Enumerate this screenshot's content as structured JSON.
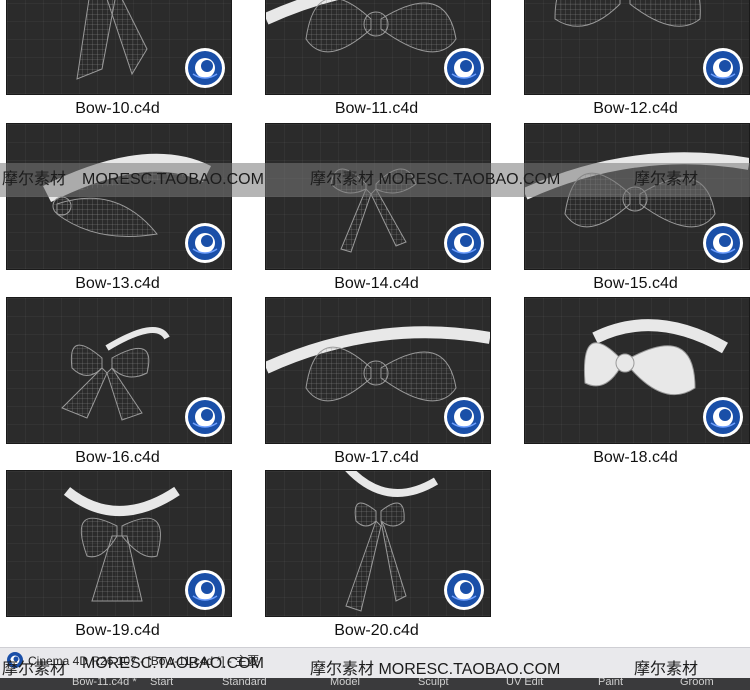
{
  "files": [
    {
      "name": "Bow-10.c4d",
      "variant": "tie"
    },
    {
      "name": "Bow-11.c4d",
      "variant": "bow-band"
    },
    {
      "name": "Bow-12.c4d",
      "variant": "bow-wide"
    },
    {
      "name": "Bow-13.c4d",
      "variant": "bow-side"
    },
    {
      "name": "Bow-14.c4d",
      "variant": "ribbon"
    },
    {
      "name": "Bow-15.c4d",
      "variant": "bow-band"
    },
    {
      "name": "Bow-16.c4d",
      "variant": "bow-cloth"
    },
    {
      "name": "Bow-17.c4d",
      "variant": "bow-band"
    },
    {
      "name": "Bow-18.c4d",
      "variant": "bow-smooth"
    },
    {
      "name": "Bow-19.c4d",
      "variant": "bow-collar"
    },
    {
      "name": "Bow-20.c4d",
      "variant": "tie-ribbon"
    }
  ],
  "watermark": {
    "text_a": "摩尔素材",
    "text_b": "MORESC.TAOBAO.COM",
    "text_c": "摩尔素材 MORESC.TAOBAO.COM",
    "text_d": "摩尔素材"
  },
  "taskbar": {
    "title": "Cinema 4D R26.107 - [Bow-11.c4d *] - 主要"
  },
  "menubar": {
    "items": [
      "Bow-11.c4d *",
      "Start",
      "Standard",
      "Model",
      "Sculpt",
      "UV Edit",
      "Paint",
      "Groom"
    ]
  },
  "colors": {
    "viewport_bg": "#2b2b2b",
    "watermark_band": "#787878",
    "logo_blue": "#1a4fa8"
  },
  "icons": {
    "logo": "cinema4d-logo-icon",
    "app": "cinema4d-app-icon"
  }
}
